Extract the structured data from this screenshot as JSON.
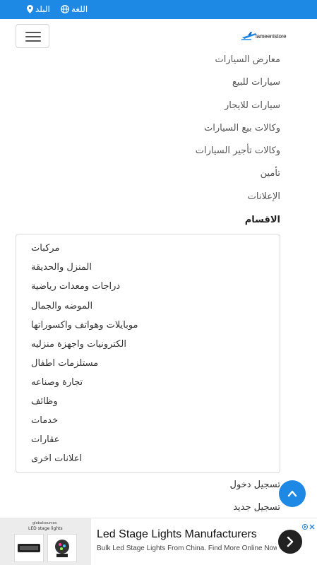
{
  "topbar": {
    "country_label": "البلد",
    "language_label": "اللغة"
  },
  "header": {
    "logo_text": "lameenistore"
  },
  "nav": {
    "links": [
      "معارض السيارات",
      "سيارات للبيع",
      "سيارات للايجار",
      "وكالات بيع السيارات",
      "وكالات تأجير السيارات",
      "تأمين",
      "الإعلانات",
      "الاقسام"
    ]
  },
  "categories": [
    "مركبات",
    "المنزل والحديقة",
    "دراجات ومعدات رياضية",
    "الموضه والجمال",
    "موبايلات وهواتف واكسوراتها",
    "الكترونيات واجهزة منزليه",
    "مستلزمات اطفال",
    "تجارة وصناعه",
    "وظائف",
    "خدمات",
    "عقارات",
    "اعلانات اخرى"
  ],
  "auth": {
    "login_label": "تسجيل دخول",
    "register_label": "تسجيل جديد"
  },
  "ad": {
    "source_label": "globalsources",
    "image_caption": "LED stage lights",
    "title": "Led Stage Lights Manufacturers",
    "description": "Bulk Led Stage Lights From China. Find More Online Now"
  },
  "colors": {
    "primary": "#1e88e5",
    "text_muted": "#555555",
    "text_dark": "#222222"
  }
}
